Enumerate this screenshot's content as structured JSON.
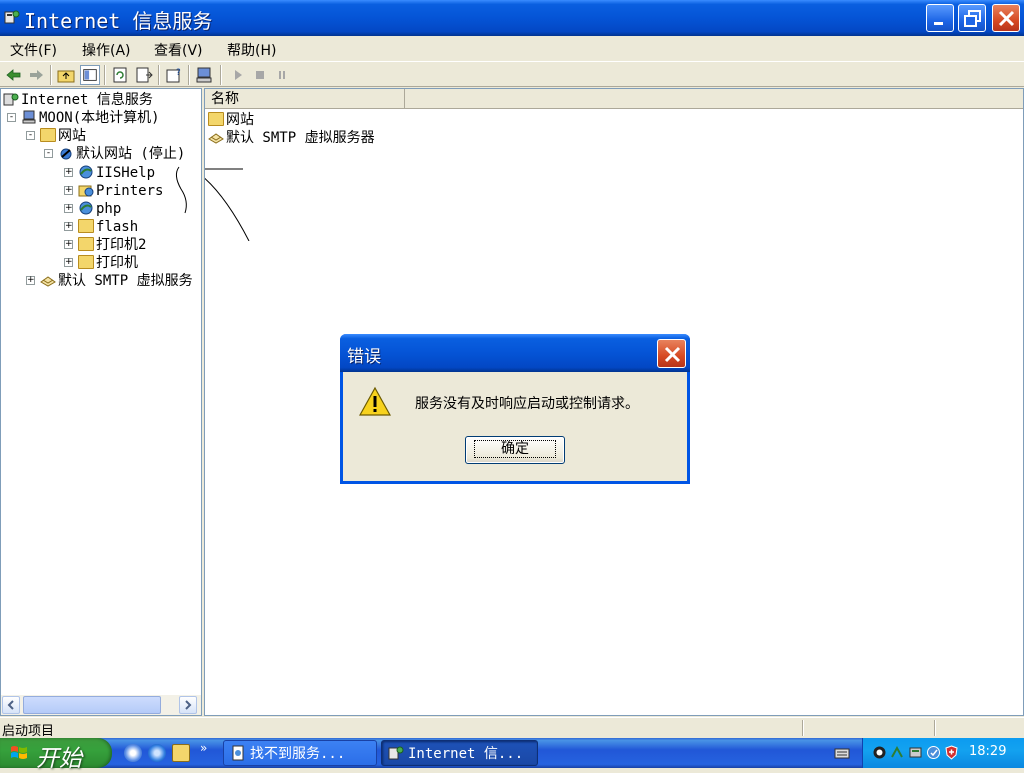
{
  "window": {
    "title": "Internet 信息服务",
    "icon": "iis-app-icon",
    "controls": [
      "minimize-icon",
      "restore-icon",
      "close-icon"
    ]
  },
  "menu": [
    {
      "label": "文件(F)"
    },
    {
      "label": "操作(A)"
    },
    {
      "label": "查看(V)"
    },
    {
      "label": "帮助(H)"
    }
  ],
  "toolbar": {
    "icons": [
      "back-arrow-icon",
      "forward-arrow-icon",
      "up-folder-icon",
      "show-hide-tree-icon",
      "refresh-icon",
      "export-list-icon",
      "properties-help-icon",
      "computer-icon",
      "start-icon",
      "stop-icon",
      "pause-icon"
    ]
  },
  "tree": [
    {
      "label": "Internet 信息服务",
      "level": 0,
      "expander": "",
      "icon": "iis-icon"
    },
    {
      "label": "MOON(本地计算机)",
      "level": 1,
      "expander": "-",
      "icon": "computer-icon"
    },
    {
      "label": "网站",
      "level": 2,
      "expander": "-",
      "icon": "folder-icon"
    },
    {
      "label": "默认网站 (停止)",
      "level": 3,
      "expander": "-",
      "icon": "website-icon"
    },
    {
      "label": "IISHelp",
      "level": 4,
      "expander": "+",
      "icon": "web-globe-icon"
    },
    {
      "label": "Printers",
      "level": 4,
      "expander": "+",
      "icon": "web-globe-icon"
    },
    {
      "label": "php",
      "level": 4,
      "expander": "+",
      "icon": "web-globe-icon"
    },
    {
      "label": "flash",
      "level": 4,
      "expander": "+",
      "icon": "folder-icon"
    },
    {
      "label": "打印机2",
      "level": 4,
      "expander": "+",
      "icon": "folder-icon"
    },
    {
      "label": "打印机",
      "level": 4,
      "expander": "+",
      "icon": "folder-icon"
    },
    {
      "label": "默认 SMTP 虚拟服务",
      "level": 1,
      "expander": "+",
      "icon": "smtp-icon"
    }
  ],
  "list": {
    "columns": [
      "名称",
      ""
    ],
    "items": [
      {
        "label": "网站",
        "icon": "folder-icon"
      },
      {
        "label": "默认 SMTP 虚拟服务器",
        "icon": "smtp-icon"
      }
    ]
  },
  "status": {
    "text": "启动项目"
  },
  "dialog": {
    "title": "错误",
    "icon": "warning-icon",
    "message": "服务没有及时响应启动或控制请求。",
    "ok_label": "确定"
  },
  "taskbar": {
    "start_label": "开始",
    "quick_launch": [
      "show-desktop-icon",
      "internet-explorer-icon",
      "explorer-icon"
    ],
    "more": "»",
    "tasks": [
      {
        "label": "找不到服务...",
        "icon": "document-icon"
      },
      {
        "label": "Internet 信...",
        "icon": "iis-app-icon"
      }
    ],
    "clock": "18:29",
    "tray_icons": [
      "qq-icon",
      "network-icon",
      "usb-icon",
      "update-icon",
      "security-shield-icon"
    ]
  },
  "colors": {
    "title_blue": "#0554d6",
    "window_bg": "#ece9d8",
    "close_red": "#d64a23",
    "start_green": "#36a13c"
  }
}
